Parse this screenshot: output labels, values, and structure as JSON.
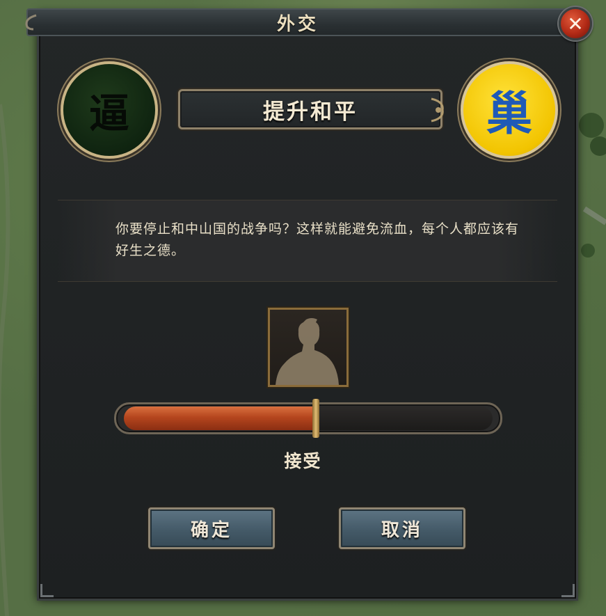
{
  "window": {
    "title": "外交"
  },
  "action": {
    "title": "提升和平"
  },
  "factions": {
    "left": {
      "glyph": "逼",
      "color": "#0f2410",
      "glyph_color": "#060b06"
    },
    "right": {
      "glyph": "巢",
      "color": "#f2c400",
      "glyph_color": "#1f5ab7"
    }
  },
  "message": {
    "text": "你要停止和中山国的战争吗？这样就能避免流血，每个人都应该有好生之德。"
  },
  "acceptance": {
    "label": "接受",
    "fraction": 0.52,
    "fill_color": "#b5461e"
  },
  "buttons": {
    "confirm": "确定",
    "cancel": "取消"
  },
  "icons": {
    "close": "close-icon",
    "portrait": "advisor-silhouette-icon"
  }
}
